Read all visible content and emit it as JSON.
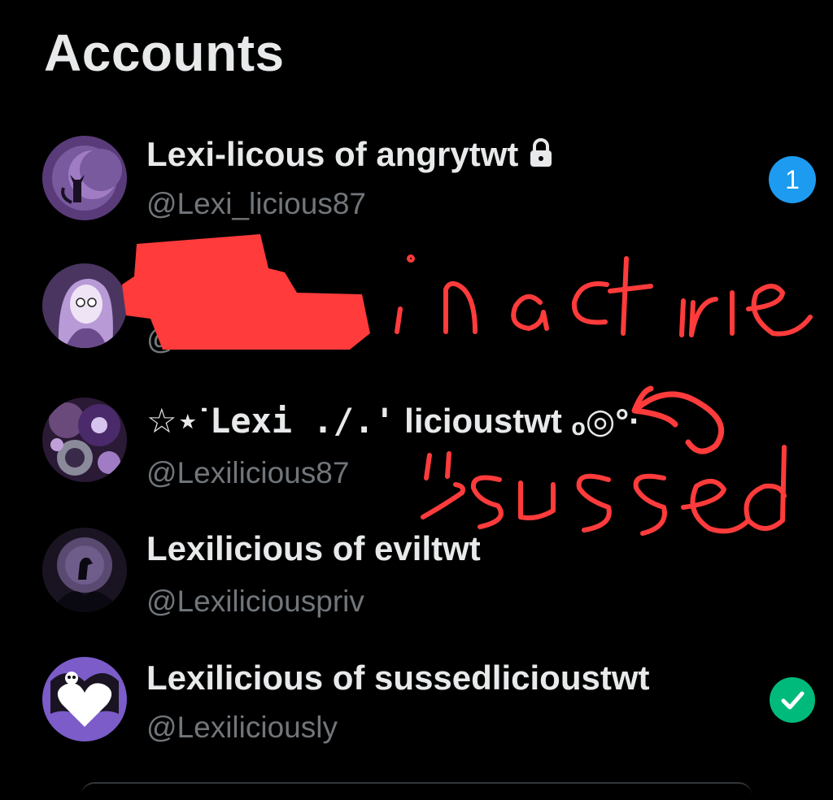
{
  "header": {
    "title": "Accounts"
  },
  "accounts": [
    {
      "display_name": "Lexi-licous of angrytwt",
      "handle": "@Lexi_licious87",
      "locked": true,
      "notification_count": "1"
    },
    {
      "display_name": "",
      "handle": "@",
      "redacted": true,
      "annotation": "inactive"
    },
    {
      "display_name_prefix": "☆⋆˙",
      "display_name_mono": "Lexi ./.'",
      "display_name_suffix": " licioustwt",
      "display_name_emoji": " ₒ◎°·",
      "handle": "@Lexilicious87",
      "annotation": "sussed"
    },
    {
      "display_name": "Lexilicious of eviltwt",
      "handle": "@Lexiliciouspriv"
    },
    {
      "display_name": "Lexilicious of sussedlicioustwt",
      "handle": "@Lexiliciously",
      "active": true
    }
  ],
  "icons": {
    "lock": "lock-icon",
    "check": "check-icon"
  },
  "colors": {
    "background": "#000000",
    "name_text": "#e7e9ea",
    "handle_text": "#71767b",
    "badge_blue": "#1d9bf0",
    "check_green": "#00ba7c",
    "scribble_red": "#ff3b3b"
  }
}
